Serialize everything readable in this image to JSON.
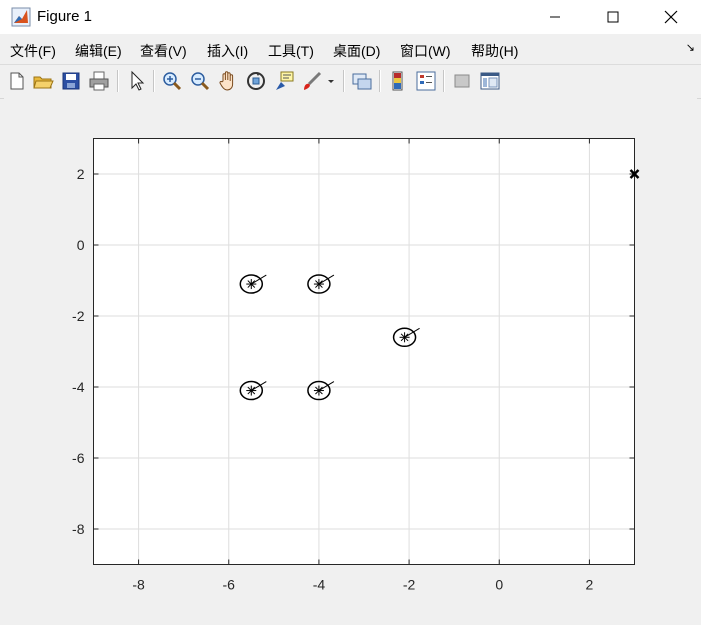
{
  "window": {
    "title": "Figure 1",
    "controls": {
      "minimize": "—",
      "maximize": "☐",
      "close": "✕"
    }
  },
  "menu": {
    "items": [
      "文件(F)",
      "编辑(E)",
      "查看(V)",
      "插入(I)",
      "工具(T)",
      "桌面(D)",
      "窗口(W)",
      "帮助(H)"
    ],
    "overflow": "↘"
  },
  "toolbar": {
    "icons": [
      "new-figure-icon",
      "open-file-icon",
      "save-icon",
      "print-icon",
      "pointer-icon",
      "zoom-in-icon",
      "zoom-out-icon",
      "pan-hand-icon",
      "rotate-3d-icon",
      "data-cursor-icon",
      "brush-icon",
      "brush-dropdown-icon",
      "link-plot-icon",
      "colorbar-icon",
      "legend-icon",
      "hide-plot-tools-icon",
      "show-plot-tools-icon"
    ]
  },
  "colors": {
    "axes_bg": "#ffffff",
    "figure_bg": "#f0f0f0",
    "grid": "#dedede",
    "marker": "#000000"
  },
  "chart_data": {
    "type": "scatter",
    "title": "",
    "xlabel": "",
    "ylabel": "",
    "xlim": [
      -9,
      3
    ],
    "ylim": [
      -9,
      3
    ],
    "xticks": [
      -8,
      -6,
      -4,
      -2,
      0,
      2
    ],
    "yticks": [
      2,
      0,
      -2,
      -4,
      -6,
      -8
    ],
    "grid": true,
    "series": [
      {
        "marker": "asterisk-circle-heading",
        "points": [
          {
            "x": -5.5,
            "y": -1.1
          },
          {
            "x": -4.0,
            "y": -1.1
          },
          {
            "x": -2.1,
            "y": -2.6
          },
          {
            "x": -5.5,
            "y": -4.1
          },
          {
            "x": -4.0,
            "y": -4.1
          }
        ]
      },
      {
        "marker": "x",
        "points": [
          {
            "x": 3.0,
            "y": 2.0
          }
        ]
      }
    ]
  }
}
